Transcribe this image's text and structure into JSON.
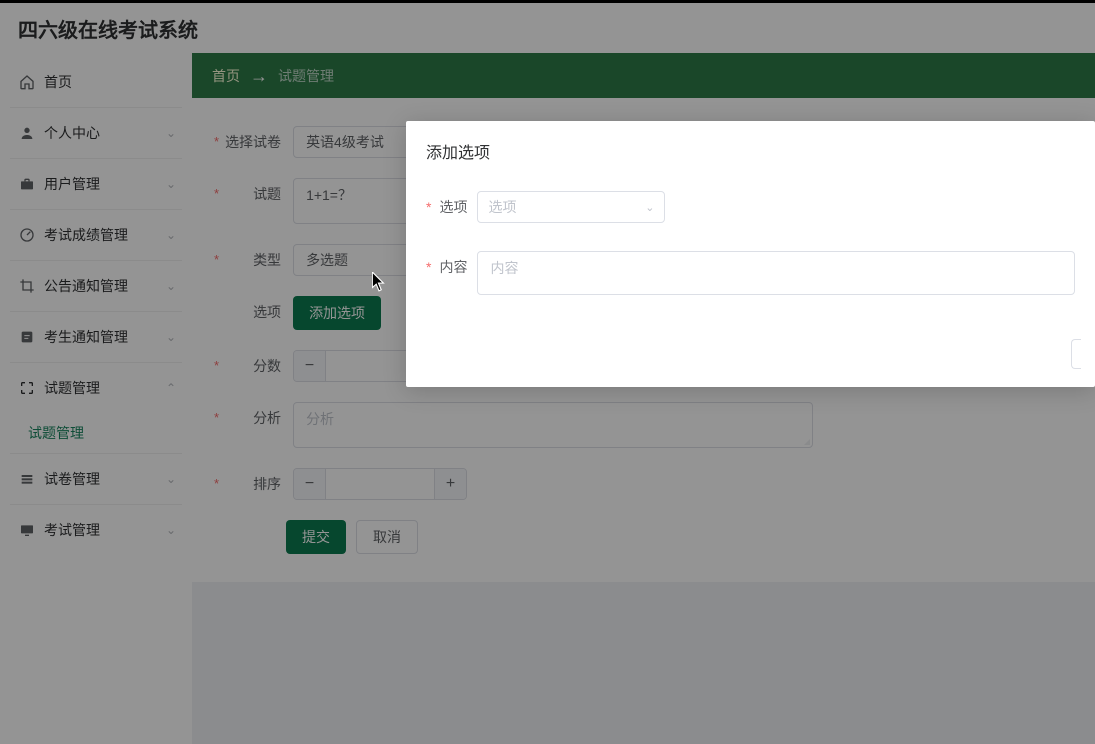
{
  "header": {
    "title": "四六级在线考试系统"
  },
  "sidebar": {
    "items": [
      {
        "label": "首页",
        "expandable": false
      },
      {
        "label": "个人中心",
        "expandable": true
      },
      {
        "label": "用户管理",
        "expandable": true
      },
      {
        "label": "考试成绩管理",
        "expandable": true
      },
      {
        "label": "公告通知管理",
        "expandable": true
      },
      {
        "label": "考生通知管理",
        "expandable": true
      },
      {
        "label": "试题管理",
        "expandable": true,
        "expanded": true
      },
      {
        "label": "试卷管理",
        "expandable": true
      },
      {
        "label": "考试管理",
        "expandable": true
      }
    ],
    "active_sub": "试题管理"
  },
  "breadcrumb": {
    "root": "首页",
    "arrow": "→",
    "leaf": "试题管理"
  },
  "form": {
    "paper": {
      "label": "选择试卷",
      "value": "英语4级考试"
    },
    "question": {
      "label": "试题",
      "value": "1+1=？"
    },
    "type": {
      "label": "类型",
      "value": "多选题"
    },
    "options": {
      "label": "选项",
      "add_button": "添加选项"
    },
    "score": {
      "label": "分数",
      "value": ""
    },
    "analysis": {
      "label": "分析",
      "placeholder": "分析",
      "value": ""
    },
    "sort": {
      "label": "排序",
      "value": ""
    },
    "submit": "提交",
    "cancel": "取消"
  },
  "modal": {
    "title": "添加选项",
    "opt": {
      "label": "选项",
      "placeholder": "选项"
    },
    "content": {
      "label": "内容",
      "placeholder": "内容"
    }
  }
}
